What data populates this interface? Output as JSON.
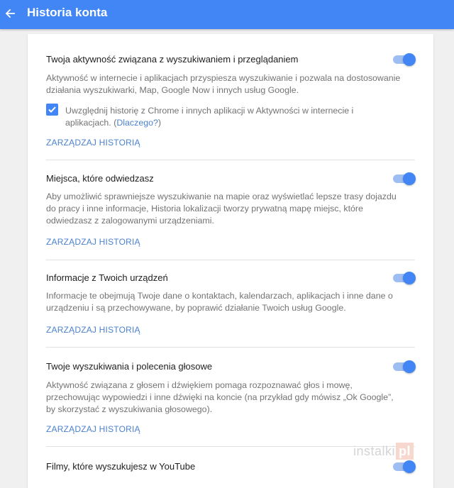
{
  "appbar": {
    "back_icon": "arrow-left-icon",
    "title": "Historia konta"
  },
  "sections": [
    {
      "title": "Twoja aktywność związana z wyszukiwaniem i przeglądaniem",
      "description": "Aktywność w internecie i aplikacjach przyspiesza wyszukiwanie i pozwala na dostosowanie działania wyszukiwarki, Map, Google Now i innych usług Google.",
      "checkbox": {
        "checked": true,
        "label": "Uwzględnij historię z Chrome i innych aplikacji w Aktywności w internecie i aplikacjach.",
        "link_open": "(",
        "link": "Dlaczego?",
        "link_close": ")"
      },
      "manage_label": "ZARZĄDZAJ HISTORIĄ",
      "toggle_on": true
    },
    {
      "title": "Miejsca, które odwiedzasz",
      "description": "Aby umożliwić sprawniejsze wyszukiwanie na mapie oraz wyświetlać lepsze trasy dojazdu do pracy i inne informacje, Historia lokalizacji tworzy prywatną mapę miejsc, które odwiedzasz z zalogowanymi urządzeniami.",
      "manage_label": "ZARZĄDZAJ HISTORIĄ",
      "toggle_on": true
    },
    {
      "title": "Informacje z Twoich urządzeń",
      "description": "Informacje te obejmują Twoje dane o kontaktach, kalendarzach, aplikacjach i inne dane o urządzeniu i są przechowywane, by poprawić działanie Twoich usług Google.",
      "manage_label": "ZARZĄDZAJ HISTORIĄ",
      "toggle_on": true
    },
    {
      "title": "Twoje wyszukiwania i polecenia głosowe",
      "description": "Aktywność związana z głosem i dźwiękiem pomaga rozpoznawać głos i mowę, przechowując wypowiedzi i inne dźwięki na koncie (na przykład gdy mówisz „Ok Google”, by skorzystać z wyszukiwania głosowego).",
      "manage_label": "ZARZĄDZAJ HISTORIĄ",
      "toggle_on": true
    },
    {
      "title": "Filmy, które wyszukujesz w YouTube",
      "toggle_on": true
    }
  ],
  "watermark": {
    "text": "instalki",
    "box_text": "pl"
  },
  "colors": {
    "appbar": "#4285f4",
    "toggle_thumb": "#4285f4",
    "toggle_track": "#9ebef3",
    "link": "#4b82cf"
  }
}
